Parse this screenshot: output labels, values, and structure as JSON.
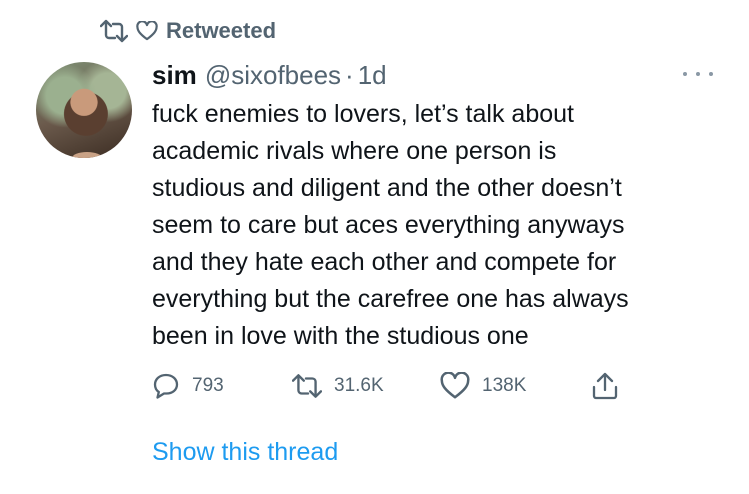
{
  "retweet_context": {
    "label": "Retweeted"
  },
  "tweet": {
    "display_name": "sim",
    "handle": "@sixofbees",
    "separator": "·",
    "time": "1d",
    "text": "fuck enemies to lovers, let’s talk about\nacademic rivals where one person is\nstudious and diligent and the other doesn’t\nseem to care but aces everything anyways\nand they hate each other and compete for\neverything but the carefree one has always\nbeen in love with the studious one",
    "replies": "793",
    "retweets": "31.6K",
    "likes": "138K"
  },
  "show_thread": "Show this thread",
  "icons": {
    "retweet": "retweet-icon",
    "heart": "heart-icon",
    "reply": "reply-icon",
    "share": "share-icon",
    "more": "more-icon"
  },
  "colors": {
    "link": "#1d9bf0",
    "muted": "#536471",
    "text": "#0f1419"
  }
}
